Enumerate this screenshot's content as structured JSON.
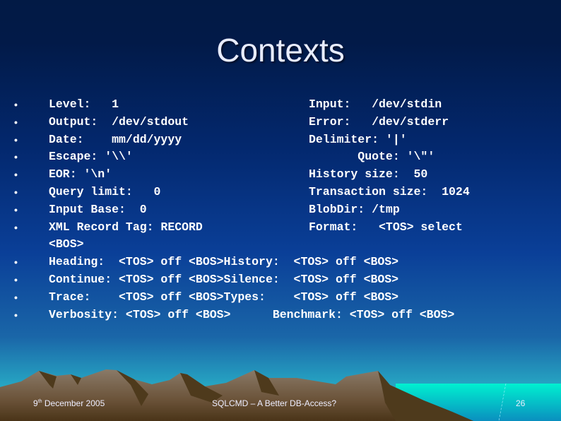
{
  "slide": {
    "title": "Contexts",
    "bullets": [
      {
        "left": "Level:   1",
        "right": "Input:   /dev/stdin"
      },
      {
        "left": "Output:  /dev/stdout",
        "right": "Error:   /dev/stderr"
      },
      {
        "left": "Date:    mm/dd/yyyy",
        "right": "Delimiter: '|'"
      },
      {
        "left": "Escape: '\\\\'",
        "right": "       Quote: '\\\"'"
      },
      {
        "left": "EOR: '\\n'",
        "right": "History size:  50"
      },
      {
        "left": "Query limit:   0",
        "right": "Transaction size:  1024"
      },
      {
        "left": "Input Base:  0",
        "right": "BlobDir: /tmp"
      },
      {
        "left": "XML Record Tag: RECORD",
        "right": "Format:   <TOS> select"
      }
    ],
    "wrap_line": "<BOS>",
    "bullets2": [
      "Heading:  <TOS> off <BOS>History:  <TOS> off <BOS>",
      "Continue: <TOS> off <BOS>Silence:  <TOS> off <BOS>",
      "Trace:    <TOS> off <BOS>Types:    <TOS> off <BOS>",
      "Verbosity: <TOS> off <BOS>      Benchmark: <TOS> off <BOS>"
    ],
    "bullet_char": "•"
  },
  "footer": {
    "date_day": "9",
    "date_suffix": "th",
    "date_rest": " December 2005",
    "center": "SQLCMD – A Better DB-Access?",
    "page": "26"
  }
}
